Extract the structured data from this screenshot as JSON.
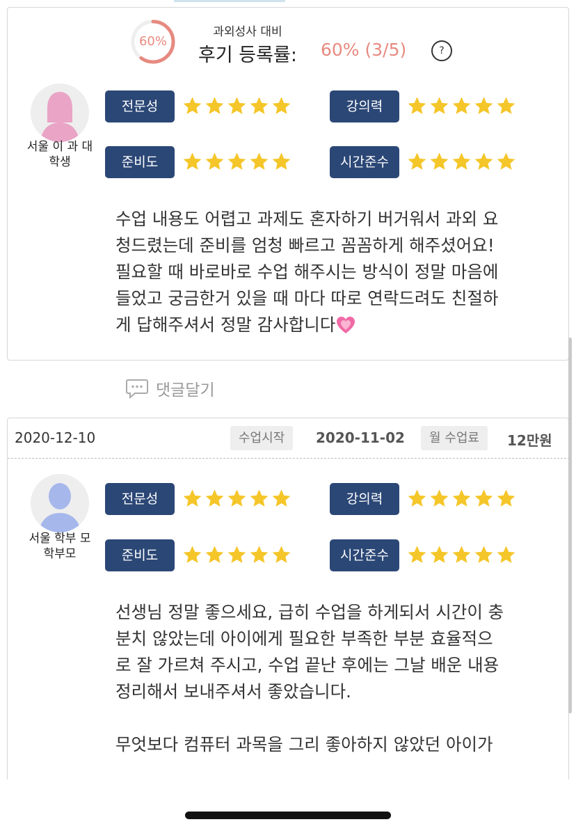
{
  "header": {
    "ring_percent_label": "60%",
    "ring_fraction": 0.6,
    "subtitle": "과외성사 대비",
    "title": "후기 등록률:",
    "value": "60% (3/5)",
    "help_label": "?",
    "accent_color": "#e78a80"
  },
  "colors": {
    "badge_bg": "#2b4776",
    "star": "#f5c629",
    "avatar_female": "#e9a4c6",
    "avatar_male": "#a6b7ec"
  },
  "reviews": [
    {
      "reviewer": "서울 이\n과 대학생",
      "avatar_icon": "female-avatar-icon",
      "ratings": [
        {
          "label": "전문성",
          "stars": 5
        },
        {
          "label": "강의력",
          "stars": 5
        },
        {
          "label": "준비도",
          "stars": 5
        },
        {
          "label": "시간준수",
          "stars": 5
        }
      ],
      "text": "수업 내용도 어렵고 과제도 혼자하기 버거워서 과외 요\n청드렸는데 준비를 엄청 빠르고 꼼꼼하게 해주셨어요!\n필요할 때 바로바로 수업 해주시는 방식이 정말 마음에\n들었고 궁금한거 있을 때 마다 따로 연락드려도 친절하\n게 답해주셔서 정말 감사합니다",
      "emoji_icon": "heart-icon"
    },
    {
      "date": "2020-12-10",
      "start_label": "수업시작",
      "start_date": "2020-11-02",
      "fee_label": "월 수업료",
      "fee": "12만원",
      "reviewer": "서울 학부\n모 학부모",
      "avatar_icon": "male-avatar-icon",
      "ratings": [
        {
          "label": "전문성",
          "stars": 5
        },
        {
          "label": "강의력",
          "stars": 5
        },
        {
          "label": "준비도",
          "stars": 5
        },
        {
          "label": "시간준수",
          "stars": 5
        }
      ],
      "text": "선생님 정말 좋으세요, 급히 수업을 하게되서 시간이 충\n분치 않았는데 아이에게 필요한 부족한 부분 효율적으\n로 잘 가르쳐 주시고, 수업 끝난 후에는 그날 배운 내용\n정리해서 보내주셔서 좋았습니다.\n\n무엇보다 컴퓨터 과목을 그리 좋아하지 않았던 아이가"
    }
  ],
  "comment_button": {
    "label": "댓글달기",
    "icon": "speech-bubble-icon"
  }
}
